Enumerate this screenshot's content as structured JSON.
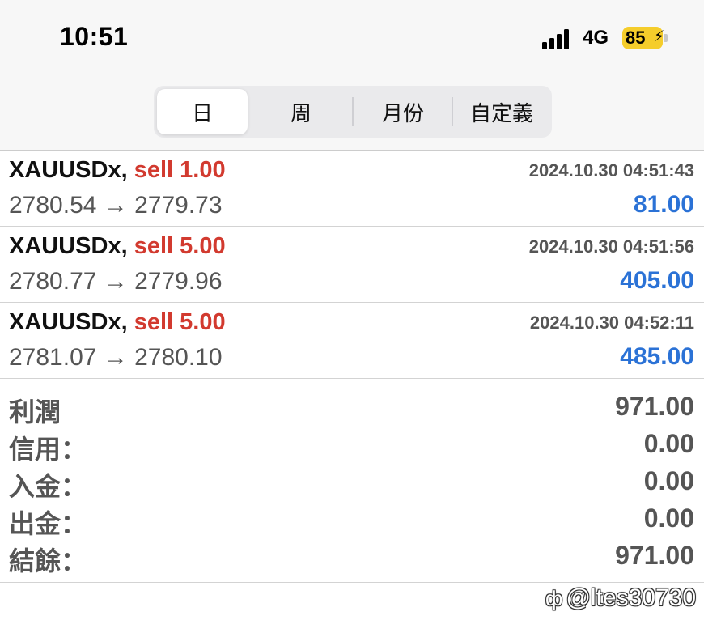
{
  "status_bar": {
    "time": "10:51",
    "network": "4G",
    "battery": "85"
  },
  "tabs": [
    {
      "label": "日",
      "active": true
    },
    {
      "label": "周",
      "active": false
    },
    {
      "label": "月份",
      "active": false
    },
    {
      "label": "自定義",
      "active": false
    }
  ],
  "trades": [
    {
      "symbol": "XAUUSDx,",
      "side": "sell 1.00",
      "timestamp": "2024.10.30 04:51:43",
      "prices": "2780.54 → 2779.73",
      "profit": "81.00"
    },
    {
      "symbol": "XAUUSDx,",
      "side": "sell 5.00",
      "timestamp": "2024.10.30 04:51:56",
      "prices": "2780.77 → 2779.96",
      "profit": "405.00"
    },
    {
      "symbol": "XAUUSDx,",
      "side": "sell 5.00",
      "timestamp": "2024.10.30 04:52:11",
      "prices": "2781.07 → 2780.10",
      "profit": "485.00"
    }
  ],
  "summary": [
    {
      "label": "利潤",
      "value": "971.00"
    },
    {
      "label": "信用：",
      "value": "0.00"
    },
    {
      "label": "入金：",
      "value": "0.00"
    },
    {
      "label": "出金：",
      "value": "0.00"
    },
    {
      "label": "結餘：",
      "value": "971.00"
    }
  ],
  "watermark": "@ltes30730",
  "colors": {
    "sell": "#d23a2f",
    "profit": "#2b72d6",
    "battery": "#f5cd2b"
  }
}
